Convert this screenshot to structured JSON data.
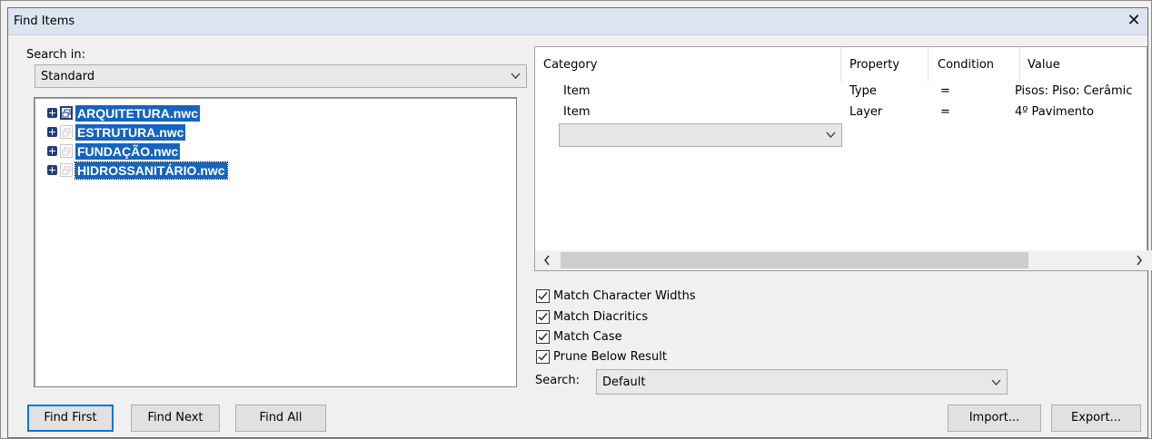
{
  "window": {
    "title": "Find Items",
    "close_glyph": "✕"
  },
  "left_panel": {
    "search_in_label": "Search in:",
    "search_in_value": "Standard",
    "tree_items": [
      {
        "label": "ARQUITETURA.nwc",
        "icon": "model-file-icon"
      },
      {
        "label": "ESTRUTURA.nwc",
        "icon": "model-file-icon"
      },
      {
        "label": "FUNDAÇÃO.nwc",
        "icon": "model-file-icon"
      },
      {
        "label": "HIDROSSANITÁRIO.nwc",
        "icon": "model-file-icon"
      }
    ]
  },
  "conditions_grid": {
    "columns": [
      "Category",
      "Property",
      "Condition",
      "Value"
    ],
    "rows": [
      {
        "category": "Item",
        "property": "Type",
        "condition": "=",
        "value": "Pisos: Piso: Cerâmic"
      },
      {
        "category": "Item",
        "property": "Layer",
        "condition": "=",
        "value": "4º Pavimento"
      }
    ],
    "new_row_category": ""
  },
  "options": {
    "match_character_widths": {
      "label": "Match Character Widths",
      "checked": true
    },
    "match_diacritics": {
      "label": "Match Diacritics",
      "checked": true
    },
    "match_case": {
      "label": "Match Case",
      "checked": true
    },
    "prune_below_result": {
      "label": "Prune Below Result",
      "checked": true
    }
  },
  "search": {
    "label": "Search:",
    "value": "Default"
  },
  "buttons": {
    "find_first": "Find First",
    "find_next": "Find Next",
    "find_all": "Find All",
    "import": "Import...",
    "export": "Export..."
  },
  "colors": {
    "selection": "#1565c0",
    "default_button_border": "#0078d7",
    "titlebar": "#dbe4f0"
  }
}
